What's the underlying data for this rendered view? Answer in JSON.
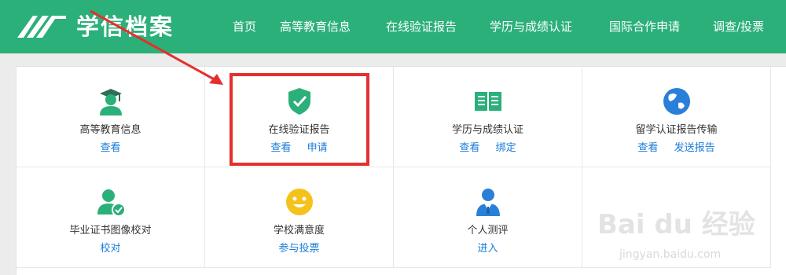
{
  "header": {
    "brand": "学信档案",
    "nav": [
      "首页",
      "高等教育信息",
      "在线验证报告",
      "学历与成绩认证",
      "国际合作申请",
      "调查/投票"
    ]
  },
  "services": [
    {
      "title": "高等教育信息",
      "icon": "graduation-icon",
      "links": [
        "查看"
      ]
    },
    {
      "title": "在线验证报告",
      "icon": "shield-check-icon",
      "links": [
        "查看",
        "申请"
      ]
    },
    {
      "title": "学历与成绩认证",
      "icon": "book-icon",
      "links": [
        "查看",
        "绑定"
      ]
    },
    {
      "title": "留学认证报告传输",
      "icon": "globe-icon",
      "links": [
        "查看",
        "发送报告"
      ]
    },
    {
      "title": "毕业证书图像校对",
      "icon": "user-check-icon",
      "links": [
        "校对"
      ]
    },
    {
      "title": "学校满意度",
      "icon": "smiley-icon",
      "links": [
        "参与投票"
      ]
    },
    {
      "title": "个人测评",
      "icon": "person-tie-icon",
      "links": [
        "进入"
      ]
    }
  ],
  "watermark": {
    "main": "Bai du 经验",
    "sub": "jingyan.baidu.com"
  },
  "colors": {
    "brand_green": "#2bb07a",
    "link_blue": "#1a7cd9",
    "highlight_red": "#e52f2f"
  }
}
